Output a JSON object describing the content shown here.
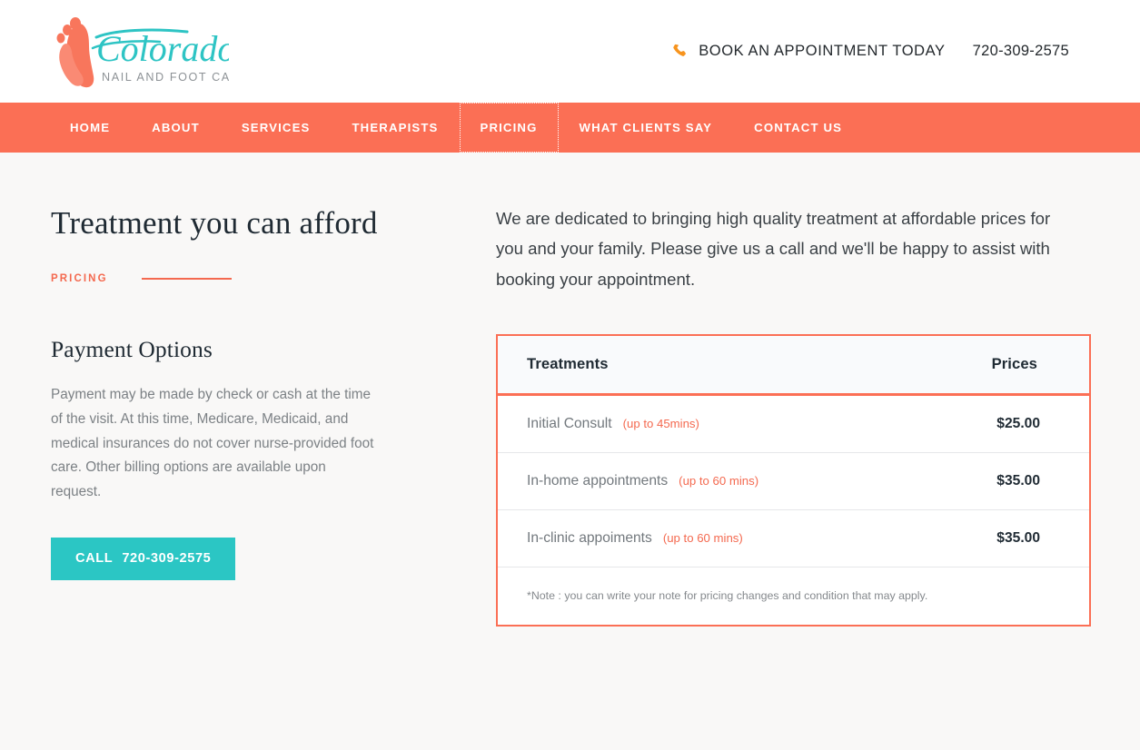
{
  "header": {
    "logo": {
      "brand_script": "Colorado",
      "brand_sub": "NAIL AND FOOT CARE",
      "script_color": "#2ec4c4",
      "mark_color": "#f8765c"
    },
    "phone_icon": "phone-icon",
    "book_label": "BOOK AN APPOINTMENT TODAY",
    "phone_number": "720-309-2575"
  },
  "nav": {
    "active": "PRICING",
    "items": [
      {
        "label": "HOME",
        "active": false
      },
      {
        "label": "ABOUT",
        "active": false
      },
      {
        "label": "SERVICES",
        "active": false
      },
      {
        "label": "THERAPISTS",
        "active": false
      },
      {
        "label": "PRICING",
        "active": true
      },
      {
        "label": "WHAT CLIENTS SAY",
        "active": false
      },
      {
        "label": "CONTACT US",
        "active": false
      }
    ]
  },
  "left": {
    "title": "Treatment you can afford",
    "eyebrow": "PRICING",
    "subheading": "Payment Options",
    "body": "Payment may be made by check or cash at the time of the visit. At this time, Medicare, Medicaid, and medical insurances do not cover nurse-provided foot care. Other billing options are available upon request.",
    "call_button": {
      "word": "CALL",
      "number": "720-309-2575"
    }
  },
  "right": {
    "intro": "We are dedicated to bringing high quality treatment at affordable prices for you and your family. Please give us a call and we'll be happy to assist with booking your appointment.",
    "table": {
      "columns": {
        "treatments": "Treatments",
        "prices": "Prices"
      },
      "rows": [
        {
          "name": "Initial Consult",
          "duration": "(up to 45mins)",
          "price": "$25.00"
        },
        {
          "name": "In-home appointments",
          "duration": "(up to 60 mins)",
          "price": "$35.00"
        },
        {
          "name": "In-clinic appoiments",
          "duration": "(up to 60 mins)",
          "price": "$35.00"
        }
      ],
      "note": "*Note : you can write your note for pricing changes and condition that may apply."
    }
  },
  "colors": {
    "coral": "#fb6f55",
    "coral_text": "#f4694f",
    "teal": "#2bc6c4",
    "orange_icon": "#f7941e",
    "page_bg": "#f9f8f7",
    "dark": "#1f2a33"
  }
}
